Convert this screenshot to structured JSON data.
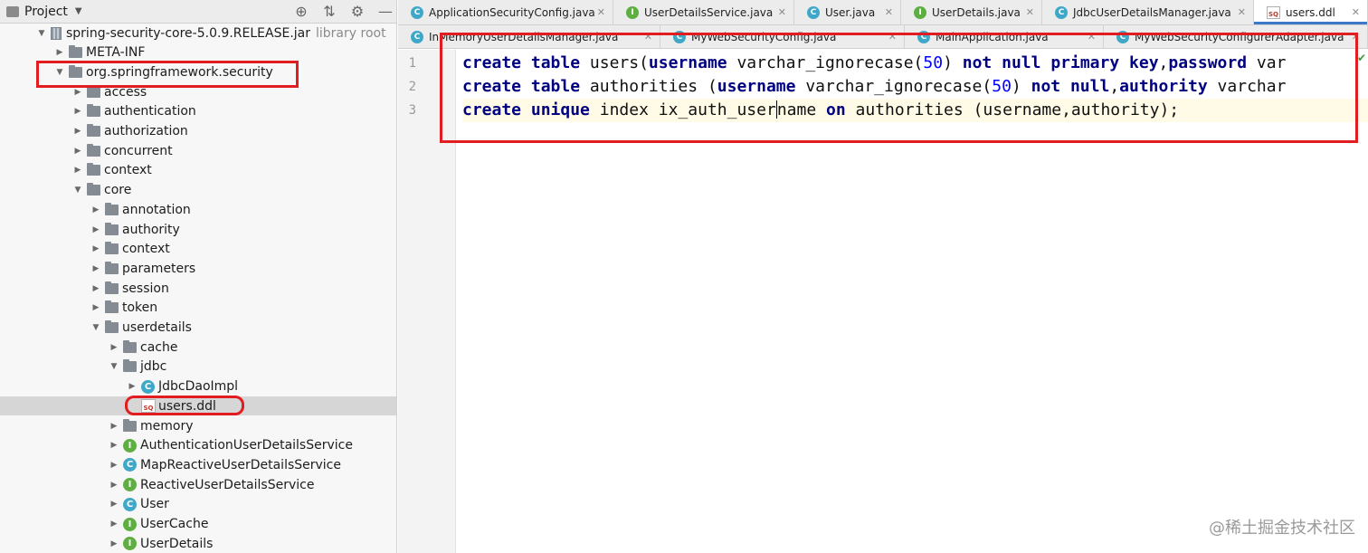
{
  "project_panel": {
    "title": "Project",
    "header_tools": [
      "crosshair-icon",
      "collapse-icon",
      "gear-icon",
      "hide-icon"
    ],
    "tree": [
      {
        "label": "spring-security-core-5.0.9.RELEASE.jar",
        "sub": "library root",
        "icon": "jar-icon",
        "arrow": "expanded"
      },
      {
        "label": "META-INF",
        "icon": "folder-icon",
        "arrow": "collapsed"
      },
      {
        "label": "org.springframework.security",
        "icon": "folder-icon",
        "arrow": "expanded"
      },
      {
        "label": "access",
        "icon": "folder-icon",
        "arrow": "collapsed"
      },
      {
        "label": "authentication",
        "icon": "folder-icon",
        "arrow": "collapsed"
      },
      {
        "label": "authorization",
        "icon": "folder-icon",
        "arrow": "collapsed"
      },
      {
        "label": "concurrent",
        "icon": "folder-icon",
        "arrow": "collapsed"
      },
      {
        "label": "context",
        "icon": "folder-icon",
        "arrow": "collapsed"
      },
      {
        "label": "core",
        "icon": "folder-icon",
        "arrow": "expanded"
      },
      {
        "label": "annotation",
        "icon": "folder-icon",
        "arrow": "collapsed"
      },
      {
        "label": "authority",
        "icon": "folder-icon",
        "arrow": "collapsed"
      },
      {
        "label": "context",
        "icon": "folder-icon",
        "arrow": "collapsed"
      },
      {
        "label": "parameters",
        "icon": "folder-icon",
        "arrow": "collapsed"
      },
      {
        "label": "session",
        "icon": "folder-icon",
        "arrow": "collapsed"
      },
      {
        "label": "token",
        "icon": "folder-icon",
        "arrow": "collapsed"
      },
      {
        "label": "userdetails",
        "icon": "folder-icon",
        "arrow": "expanded"
      },
      {
        "label": "cache",
        "icon": "folder-icon",
        "arrow": "collapsed"
      },
      {
        "label": "jdbc",
        "icon": "folder-icon",
        "arrow": "expanded"
      },
      {
        "label": "JdbcDaoImpl",
        "icon": "class-icon",
        "badge": "C",
        "arrow": "collapsed"
      },
      {
        "label": "users.ddl",
        "icon": "sql-file-icon",
        "badge": "SQL",
        "arrow": "none",
        "selected": true
      },
      {
        "label": "memory",
        "icon": "folder-icon",
        "arrow": "collapsed"
      },
      {
        "label": "AuthenticationUserDetailsService",
        "icon": "interface-icon",
        "badge": "I",
        "arrow": "collapsed"
      },
      {
        "label": "MapReactiveUserDetailsService",
        "icon": "class-icon",
        "badge": "C",
        "arrow": "collapsed"
      },
      {
        "label": "ReactiveUserDetailsService",
        "icon": "interface-icon",
        "badge": "I",
        "arrow": "collapsed"
      },
      {
        "label": "User",
        "icon": "class-icon",
        "badge": "C",
        "arrow": "collapsed"
      },
      {
        "label": "UserCache",
        "icon": "interface-icon",
        "badge": "I",
        "arrow": "collapsed"
      },
      {
        "label": "UserDetails",
        "icon": "interface-icon",
        "badge": "I",
        "arrow": "collapsed"
      }
    ]
  },
  "tabs_row1": [
    {
      "label": "ApplicationSecurityConfig.java",
      "badge": "C"
    },
    {
      "label": "UserDetailsService.java",
      "badge": "I"
    },
    {
      "label": "User.java",
      "badge": "C"
    },
    {
      "label": "UserDetails.java",
      "badge": "I"
    },
    {
      "label": "JdbcUserDetailsManager.java",
      "badge": "C"
    },
    {
      "label": "users.ddl",
      "badge": "SQL",
      "active": true
    }
  ],
  "tabs_row2": [
    {
      "label": "InMemoryUserDetailsManager.java",
      "badge": "C"
    },
    {
      "label": "MyWebSecurityConfig.java",
      "badge": "C"
    },
    {
      "label": "MainApplication.java",
      "badge": "C"
    },
    {
      "label": "MyWebSecurityConfigurerAdapter.java",
      "badge": "C"
    }
  ],
  "editor": {
    "line_numbers": [
      "1",
      "2",
      "3"
    ],
    "lines": [
      [
        {
          "t": "create",
          "k": "kw"
        },
        {
          "t": " "
        },
        {
          "t": "table",
          "k": "kw"
        },
        {
          "t": " users("
        },
        {
          "t": "username",
          "k": "kw"
        },
        {
          "t": " varchar_ignorecase("
        },
        {
          "t": "50",
          "k": "num"
        },
        {
          "t": ") "
        },
        {
          "t": "not",
          "k": "kw"
        },
        {
          "t": " "
        },
        {
          "t": "null",
          "k": "kw"
        },
        {
          "t": " "
        },
        {
          "t": "primary",
          "k": "kw"
        },
        {
          "t": " "
        },
        {
          "t": "key",
          "k": "kw"
        },
        {
          "t": ","
        },
        {
          "t": "password",
          "k": "kw"
        },
        {
          "t": " var"
        }
      ],
      [
        {
          "t": "create",
          "k": "kw"
        },
        {
          "t": " "
        },
        {
          "t": "table",
          "k": "kw"
        },
        {
          "t": " authorities ("
        },
        {
          "t": "username",
          "k": "kw"
        },
        {
          "t": " varchar_ignorecase("
        },
        {
          "t": "50",
          "k": "num"
        },
        {
          "t": ") "
        },
        {
          "t": "not",
          "k": "kw"
        },
        {
          "t": " "
        },
        {
          "t": "null",
          "k": "kw"
        },
        {
          "t": ","
        },
        {
          "t": "authority",
          "k": "kw"
        },
        {
          "t": " varchar"
        }
      ],
      [
        {
          "t": "create",
          "k": "kw"
        },
        {
          "t": " "
        },
        {
          "t": "unique",
          "k": "kw"
        },
        {
          "t": " index ix_auth_user"
        },
        {
          "t": "",
          "k": "caret"
        },
        {
          "t": "name "
        },
        {
          "t": "on",
          "k": "kw"
        },
        {
          "t": " authorities (username,authority);"
        }
      ]
    ],
    "current_line": 2
  },
  "watermark": "@稀土掘金技术社区"
}
